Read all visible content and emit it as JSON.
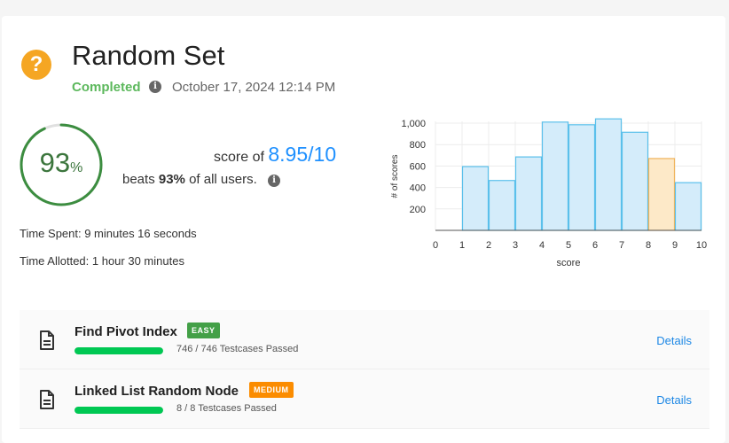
{
  "header": {
    "icon": "question-icon",
    "title": "Random Set",
    "status": "Completed",
    "date": "October 17, 2024 12:14 PM"
  },
  "summary": {
    "percent_value": "93",
    "percent_sign": "%",
    "percent_fraction": 0.93,
    "score_prefix": "score of",
    "score_value": "8.95/10",
    "beats_prefix": "beats",
    "beats_value": "93%",
    "beats_suffix": "of all users.",
    "time_spent": "Time Spent: 9 minutes 16 seconds",
    "time_allotted": "Time Allotted: 1 hour 30 minutes"
  },
  "colors": {
    "brand_orange": "#f5a623",
    "completed_green": "#5cb85c",
    "score_blue": "#1e90ff",
    "bar_fill": "#d4ecfa",
    "bar_stroke": "#5bc0eb",
    "highlight_fill": "#fde9c8",
    "highlight_stroke": "#f0b35a"
  },
  "chart_data": {
    "type": "bar",
    "xlabel": "score",
    "ylabel": "# of scores",
    "x_ticks": [
      "0",
      "1",
      "2",
      "3",
      "4",
      "5",
      "6",
      "7",
      "8",
      "9",
      "10"
    ],
    "y_ticks": [
      "200",
      "400",
      "600",
      "800",
      "1,000"
    ],
    "ylim": [
      0,
      1000
    ],
    "bins": [
      {
        "from": 0,
        "to": 1,
        "value": 0
      },
      {
        "from": 1,
        "to": 2,
        "value": 595
      },
      {
        "from": 2,
        "to": 3,
        "value": 465
      },
      {
        "from": 3,
        "to": 4,
        "value": 685
      },
      {
        "from": 4,
        "to": 5,
        "value": 1010
      },
      {
        "from": 5,
        "to": 6,
        "value": 985
      },
      {
        "from": 6,
        "to": 7,
        "value": 1040
      },
      {
        "from": 7,
        "to": 8,
        "value": 915
      },
      {
        "from": 8,
        "to": 9,
        "value": 670,
        "highlight": true
      },
      {
        "from": 9,
        "to": 10,
        "value": 445
      }
    ],
    "grid": true
  },
  "questions": [
    {
      "title": "Find Pivot Index",
      "difficulty": "EASY",
      "passed_text": "746 / 746 Testcases Passed",
      "progress_fraction": 1.0,
      "details_label": "Details",
      "icon": "document-icon"
    },
    {
      "title": "Linked List Random Node",
      "difficulty": "MEDIUM",
      "passed_text": "8 / 8 Testcases Passed",
      "progress_fraction": 1.0,
      "details_label": "Details",
      "icon": "document-icon"
    }
  ]
}
